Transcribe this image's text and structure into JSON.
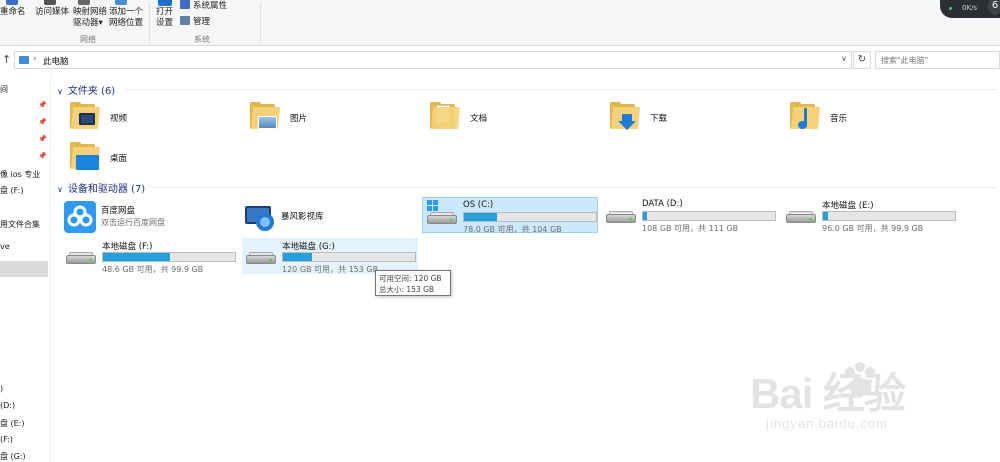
{
  "ribbon": {
    "rename": "重命名",
    "access_media": "访问媒体",
    "map_drive_l1": "映射网络",
    "map_drive_l2": "驱动器",
    "map_drive_arrow": "▾",
    "add_location_l1": "添加一个",
    "add_location_l2": "网络位置",
    "open_settings_l1": "打开",
    "open_settings_l2": "设置",
    "system_properties": "系统属性",
    "manage": "管理",
    "group_network": "网络",
    "group_system": "系统"
  },
  "net_widget": {
    "speed": "0K/s",
    "badge": "6"
  },
  "address": {
    "up_arrow": "↑",
    "chevron": "›",
    "path": "此电脑",
    "dropdown": "∨",
    "refresh": "↻",
    "search_placeholder": "搜索\"此电脑\""
  },
  "nav": {
    "pin": "📌",
    "items": [
      "间",
      "像 ios 专业",
      "盘 (F:)",
      "用文件合集",
      "ve",
      ")",
      "(D:)",
      "盘 (E:)",
      "(F:)",
      "盘 (G:)"
    ]
  },
  "folders_section": {
    "title": "文件夹 (6)",
    "chevron": "∨",
    "items": [
      {
        "label": "视频",
        "icon": "videos-folder-icon"
      },
      {
        "label": "图片",
        "icon": "pictures-folder-icon"
      },
      {
        "label": "文档",
        "icon": "documents-folder-icon"
      },
      {
        "label": "下载",
        "icon": "downloads-folder-icon"
      },
      {
        "label": "音乐",
        "icon": "music-folder-icon"
      },
      {
        "label": "桌面",
        "icon": "desktop-folder-icon"
      }
    ]
  },
  "devices_section": {
    "title": "设备和驱动器 (7)",
    "chevron": "∨",
    "apps": [
      {
        "name": "百度网盘",
        "sub": "双击运行百度网盘",
        "icon": "baidu-netdisk-icon"
      },
      {
        "name": "暴风影视库",
        "sub": "",
        "icon": "baofeng-video-icon"
      }
    ],
    "drives": [
      {
        "name": "OS (C:)",
        "info": "78.0 GB 可用，共 104 GB",
        "used_fraction": 0.25,
        "icon": "windows-drive-icon"
      },
      {
        "name": "DATA (D:)",
        "info": "108 GB 可用，共 111 GB",
        "used_fraction": 0.03,
        "icon": "hard-drive-icon"
      },
      {
        "name": "本地磁盘 (E:)",
        "info": "96.0 GB 可用，共 99.9 GB",
        "used_fraction": 0.04,
        "icon": "hard-drive-icon"
      },
      {
        "name": "本地磁盘 (F:)",
        "info": "48.6 GB 可用，共 99.9 GB",
        "used_fraction": 0.51,
        "icon": "hard-drive-icon"
      },
      {
        "name": "本地磁盘 (G:)",
        "info": "120 GB 可用，共 153 GB",
        "used_fraction": 0.22,
        "icon": "hard-drive-icon"
      }
    ]
  },
  "tooltip": {
    "line1": "可用空间: 120 GB",
    "line2": "总大小: 153 GB"
  },
  "watermark": {
    "brand": "Bai  经验",
    "url": "jingyan.baidu.com"
  },
  "colors": {
    "accent": "#26a0da",
    "selection": "#cce8ff",
    "section_title": "#1e3287"
  }
}
